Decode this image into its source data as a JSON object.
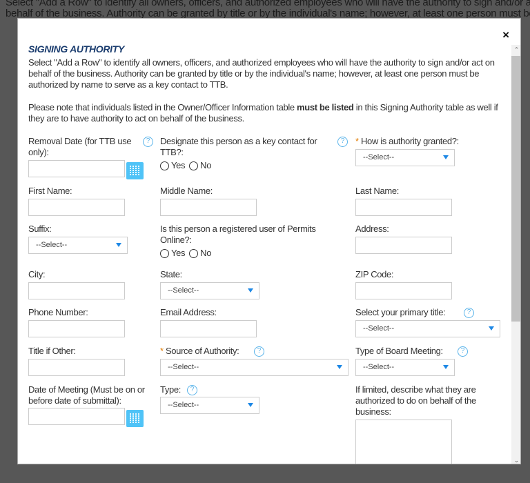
{
  "background": {
    "line1": "Select \"Add a Row\" to identify all owners, officers, and authorized employees who will have the authority to sign and/or act on",
    "line2": "behalf of the business. Authority can be granted by title or by the individual's name; however, at least one person must be"
  },
  "modal": {
    "close_label": "×",
    "title": "SIGNING AUTHORITY",
    "intro": "Select \"Add a Row\" to identify all owners, officers, and authorized employees who will have the authority to sign and/or act on behalf of the business. Authority can be granted by title or by the individual's name; however, at least one person must be authorized by name to serve as a key contact to TTB.",
    "note_pre": "Please note that individuals listed in the Owner/Officer Information table ",
    "note_bold": "must be listed",
    "note_post": " in this Signing Authority table as well if they are to have authority to act on behalf of the business.",
    "help_glyph": "?",
    "required_mark": "*",
    "select_placeholder": "--Select--",
    "yes": "Yes",
    "no": "No",
    "fields": {
      "removal_date": "Removal Date (for TTB use only):",
      "key_contact": "Designate this person as a key contact for TTB?:",
      "how_granted": "How is authority granted?:",
      "first_name": "First Name:",
      "middle_name": "Middle Name:",
      "last_name": "Last Name:",
      "suffix": "Suffix:",
      "registered_user": "Is this person a registered user of Permits Online?:",
      "address": "Address:",
      "city": "City:",
      "state": "State:",
      "zip": "ZIP Code:",
      "phone": "Phone Number:",
      "email": "Email Address:",
      "primary_title": "Select your primary title:",
      "title_other": "Title if Other:",
      "source_authority": "Source of Authority:",
      "board_meeting": "Type of Board Meeting:",
      "meeting_date": "Date of Meeting (Must be on or before date of submittal):",
      "type": "Type:",
      "limited_desc": "If limited, describe what they are authorized to do on behalf of the business:"
    }
  },
  "colors": {
    "title": "#1a3c6e",
    "accent": "#4fc3f7",
    "required": "#e07b00"
  },
  "icons": {
    "calendar": "calendar-icon",
    "help": "help-icon",
    "dropdown": "caret-down-icon"
  }
}
